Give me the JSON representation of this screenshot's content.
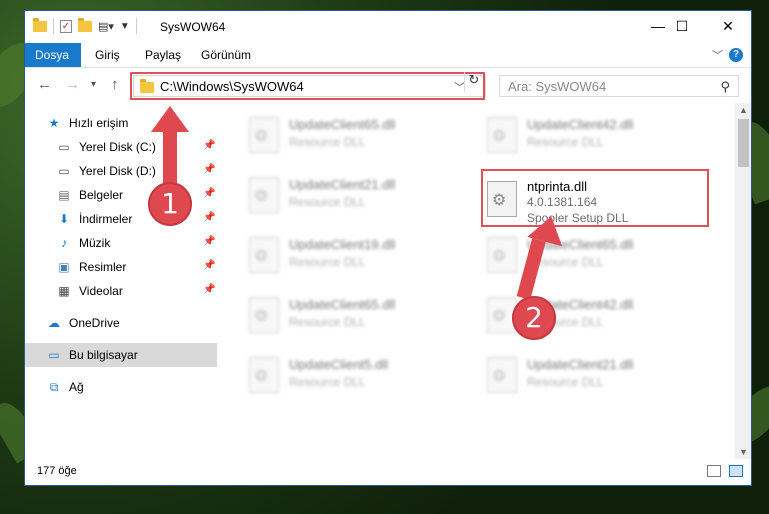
{
  "window": {
    "title": "SysWOW64"
  },
  "ribbon": {
    "tabs": [
      "Dosya",
      "Giriş",
      "Paylaş",
      "Görünüm"
    ]
  },
  "address": {
    "path": "C:\\Windows\\SysWOW64",
    "search_placeholder": "Ara: SysWOW64"
  },
  "nav": {
    "quick_access": "Hızlı erişim",
    "items": [
      "Yerel Disk (C:)",
      "Yerel Disk (D:)",
      "Belgeler",
      "İndirmeler",
      "Müzik",
      "Resimler",
      "Videolar"
    ],
    "onedrive": "OneDrive",
    "this_pc": "Bu bilgisayar",
    "network": "Ağ"
  },
  "files": {
    "blurred": [
      {
        "name": "UpdateClient65.dll",
        "desc": "Resource DLL"
      },
      {
        "name": "UpdateClient42.dll",
        "desc": "Resource DLL"
      },
      {
        "name": "UpdateClient21.dll",
        "desc": "Resource DLL"
      },
      {
        "name": "UpdateClient19.dll",
        "desc": "Resource DLL"
      },
      {
        "name": "UpdateClient65.dll",
        "desc": "Resource DLL"
      },
      {
        "name": "UpdateClient65.dll",
        "desc": "Resource DLL"
      },
      {
        "name": "UpdateClient42.dll",
        "desc": "Resource DLL"
      },
      {
        "name": "UpdateClient5.dll",
        "desc": "Resource DLL"
      },
      {
        "name": "UpdateClient21.dll",
        "desc": "Resource DLL"
      }
    ],
    "target": {
      "name": "ntprinta.dll",
      "version": "4.0.1381.164",
      "desc": "Spooler Setup DLL"
    }
  },
  "status": {
    "count": "177 öğe"
  },
  "annotations": {
    "step1": "1",
    "step2": "2"
  },
  "colors": {
    "accent": "#1979ca",
    "highlight": "#e05058"
  }
}
